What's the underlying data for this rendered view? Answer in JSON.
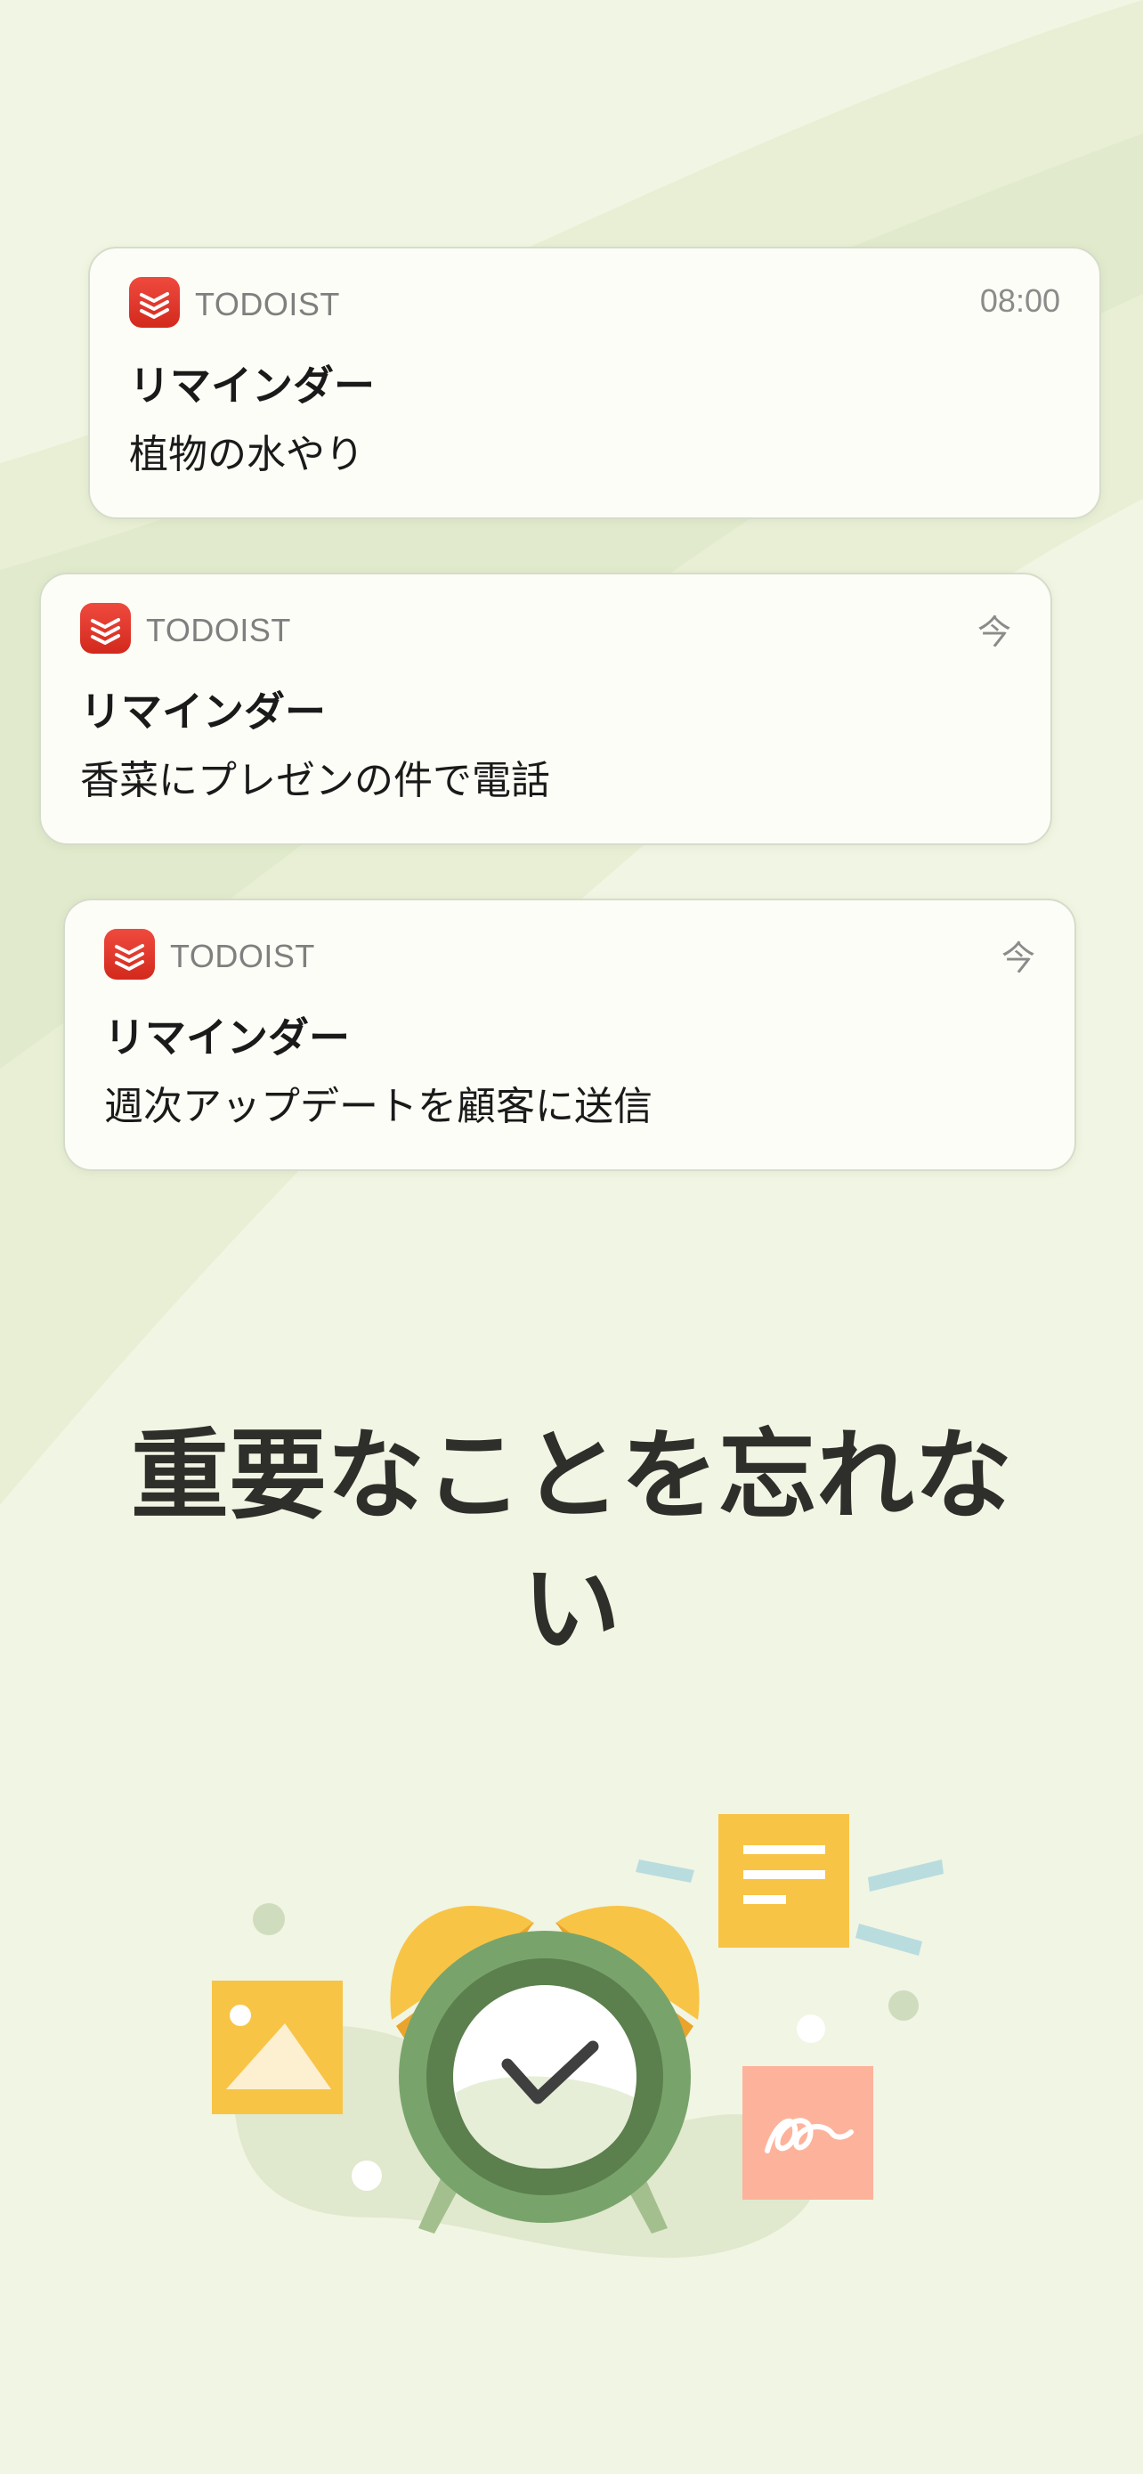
{
  "notifications": [
    {
      "app_name": "TODOIST",
      "time": "08:00",
      "title": "リマインダー",
      "body": "植物の水やり"
    },
    {
      "app_name": "TODOIST",
      "time": "今",
      "title": "リマインダー",
      "body": "香菜にプレゼンの件で電話"
    },
    {
      "app_name": "TODOIST",
      "time": "今",
      "title": "リマインダー",
      "body": "週次アップデートを顧客に送信"
    }
  ],
  "headline": {
    "line1": "重要なことを忘れな",
    "line2": "い"
  },
  "colors": {
    "background": "#f1f5e3",
    "card": "#fdfdf7",
    "todoist_red": "#e2352a",
    "headline": "#2e2e2a",
    "clock_green": "#6f9a62",
    "bell_yellow": "#f8c446",
    "note_pink": "#fdb39b"
  },
  "icons": [
    "todoist-logo-icon",
    "alarm-clock-illustration",
    "image-card-icon",
    "note-card-icon",
    "signature-card-icon"
  ]
}
